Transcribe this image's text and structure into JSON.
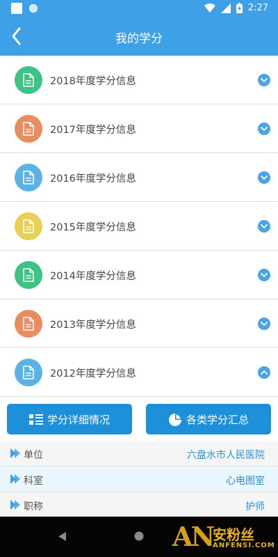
{
  "status_bar": {
    "time": "2:27"
  },
  "header": {
    "title": "我的学分"
  },
  "year_items": [
    {
      "label": "2018年度学分信息",
      "color": "#3ec285",
      "expanded": false
    },
    {
      "label": "2017年度学分信息",
      "color": "#e98c5e",
      "expanded": false
    },
    {
      "label": "2016年度学分信息",
      "color": "#5bb2e6",
      "expanded": false
    },
    {
      "label": "2015年度学分信息",
      "color": "#e8d052",
      "expanded": false
    },
    {
      "label": "2014年度学分信息",
      "color": "#3ec285",
      "expanded": false
    },
    {
      "label": "2013年度学分信息",
      "color": "#e98c5e",
      "expanded": false
    },
    {
      "label": "2012年度学分信息",
      "color": "#5bb2e6",
      "expanded": true
    }
  ],
  "buttons": {
    "detail_label": "学分详细情况",
    "summary_label": "各类学分汇总"
  },
  "info": [
    {
      "key": "单位",
      "value": "六盘水市人民医院"
    },
    {
      "key": "科室",
      "value": "心电图室"
    },
    {
      "key": "职称",
      "value": "护师"
    }
  ],
  "watermark": {
    "logo": "AN",
    "cn": "安粉丝",
    "en": "ANFENSI.COM"
  },
  "colors": {
    "primary": "#3ea0e6",
    "button": "#1e8fd9",
    "accent_text": "#2a8fd6"
  }
}
